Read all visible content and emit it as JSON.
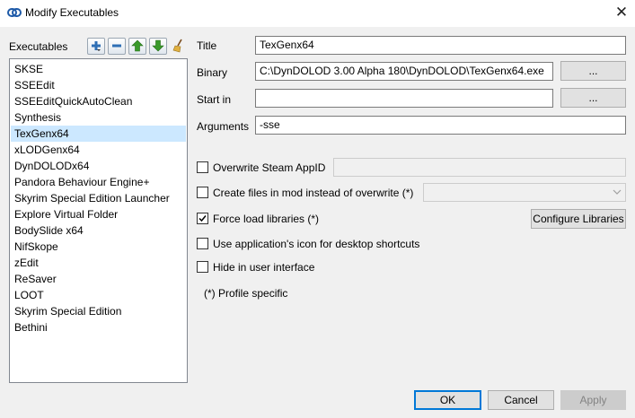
{
  "window": {
    "title": "Modify Executables",
    "close_glyph": "✕"
  },
  "icons": {
    "app": "chain-link-icon",
    "add": "plus-icon",
    "remove": "minus-icon",
    "up": "arrow-up-icon",
    "down": "arrow-down-icon",
    "clean": "broom-icon",
    "colors": {
      "add_remove": "#2f6fb5",
      "arrows": "#3a9a2a",
      "broom": "#c79a2c"
    }
  },
  "sidebar": {
    "label": "Executables",
    "items": [
      {
        "label": "SKSE"
      },
      {
        "label": "SSEEdit"
      },
      {
        "label": "SSEEditQuickAutoClean"
      },
      {
        "label": "Synthesis"
      },
      {
        "label": "TexGenx64",
        "selected": true
      },
      {
        "label": "xLODGenx64"
      },
      {
        "label": "DynDOLODx64"
      },
      {
        "label": "Pandora Behaviour Engine+"
      },
      {
        "label": "Skyrim Special Edition Launcher"
      },
      {
        "label": "Explore Virtual Folder"
      },
      {
        "label": "BodySlide x64"
      },
      {
        "label": "NifSkope"
      },
      {
        "label": "zEdit"
      },
      {
        "label": "ReSaver"
      },
      {
        "label": "LOOT"
      },
      {
        "label": "Skyrim Special Edition"
      },
      {
        "label": "Bethini"
      }
    ]
  },
  "form": {
    "title_label": "Title",
    "title_value": "TexGenx64",
    "binary_label": "Binary",
    "binary_value": "C:\\DynDOLOD 3.00 Alpha 180\\DynDOLOD\\TexGenx64.exe",
    "binary_browse": "...",
    "startin_label": "Start in",
    "startin_value": "",
    "startin_browse": "...",
    "arguments_label": "Arguments",
    "arguments_value": "-sse"
  },
  "options": {
    "steam_appid_label": "Overwrite Steam AppID",
    "steam_appid_checked": false,
    "steam_appid_value": "",
    "create_files_label": "Create files in mod instead of overwrite (*)",
    "create_files_checked": false,
    "create_files_selected": "",
    "force_load_label": "Force load libraries (*)",
    "force_load_checked": true,
    "configure_libraries": "Configure Libraries",
    "app_icon_label": "Use application's icon for desktop shortcuts",
    "app_icon_checked": false,
    "hide_label": "Hide in user interface",
    "hide_checked": false,
    "profile_note": "(*) Profile specific"
  },
  "footer": {
    "ok": "OK",
    "cancel": "Cancel",
    "apply": "Apply"
  },
  "colors": {
    "selection": "#cce8ff",
    "default_button_border": "#0078d7"
  }
}
